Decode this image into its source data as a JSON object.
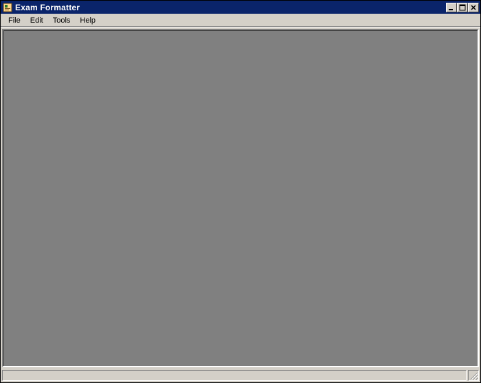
{
  "window": {
    "title": "Exam Formatter"
  },
  "menubar": {
    "items": [
      {
        "label": "File"
      },
      {
        "label": "Edit"
      },
      {
        "label": "Tools"
      },
      {
        "label": "Help"
      }
    ]
  },
  "statusbar": {
    "text": ""
  },
  "icons": {
    "app": "app-icon",
    "minimize": "minimize-icon",
    "maximize": "maximize-icon",
    "close": "close-icon",
    "resize": "resize-grip-icon"
  }
}
